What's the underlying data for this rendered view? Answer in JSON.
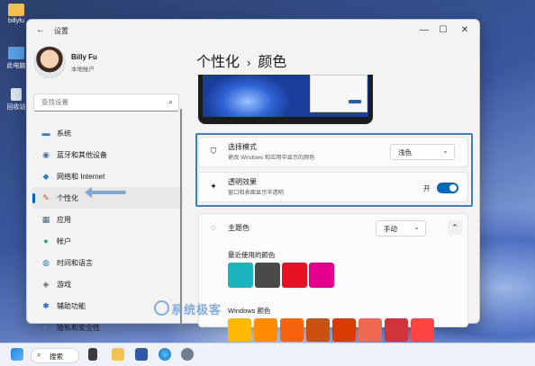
{
  "desktop": {
    "icons": [
      {
        "label": "billyfu",
        "icon": "folder-icon",
        "color": "#f2c14e"
      },
      {
        "label": "此电脑",
        "icon": "computer-icon",
        "color": "#5aa0e6"
      },
      {
        "label": "回收站",
        "icon": "recycle-bin-icon",
        "color": "#dfe6ef"
      }
    ]
  },
  "window": {
    "title": "设置",
    "controls": {
      "minimize": "—",
      "maximize": "☐",
      "close": "✕"
    }
  },
  "profile": {
    "name": "Billy Fu",
    "account_type": "本地帐户"
  },
  "search": {
    "placeholder": "查找设置"
  },
  "sidebar": {
    "items": [
      {
        "label": "系统",
        "icon": "system-icon",
        "glyph": "▬",
        "color": "#2b7bd0"
      },
      {
        "label": "蓝牙和其他设备",
        "icon": "bluetooth-icon",
        "glyph": "◉",
        "color": "#3a6fb8"
      },
      {
        "label": "网络和 Internet",
        "icon": "wifi-icon",
        "glyph": "◆",
        "color": "#2f7fcf"
      },
      {
        "label": "个性化",
        "icon": "brush-icon",
        "glyph": "✎",
        "color": "#c05a2a",
        "active": true
      },
      {
        "label": "应用",
        "icon": "apps-icon",
        "glyph": "▦",
        "color": "#4a5f7e"
      },
      {
        "label": "帐户",
        "icon": "person-icon",
        "glyph": "●",
        "color": "#2ba26a"
      },
      {
        "label": "时间和语言",
        "icon": "globe-clock-icon",
        "glyph": "◍",
        "color": "#2a7bc9"
      },
      {
        "label": "游戏",
        "icon": "gamepad-icon",
        "glyph": "◈",
        "color": "#5f6b78"
      },
      {
        "label": "辅助功能",
        "icon": "accessibility-icon",
        "glyph": "✱",
        "color": "#1f6fc8"
      },
      {
        "label": "隐私和安全性",
        "icon": "shield-icon",
        "glyph": "◐",
        "color": "#6a7788"
      }
    ]
  },
  "breadcrumb": {
    "parent": "个性化",
    "separator": "›",
    "current": "颜色"
  },
  "settings": {
    "mode": {
      "title": "选择模式",
      "desc": "更改 Windows 和应用中显示的颜色",
      "value": "浅色"
    },
    "transparency": {
      "title": "透明效果",
      "desc": "窗口和表面显示半透明",
      "state_label": "开",
      "on": true
    },
    "accent": {
      "title": "主题色",
      "value": "手动"
    },
    "recent_label": "最近使用的颜色",
    "recent_colors": [
      "#1bb5bf",
      "#4a4a4a",
      "#e81123",
      "#e3008c"
    ],
    "windows_colors_label": "Windows 颜色",
    "windows_colors": [
      "#ffb900",
      "#ff8c00",
      "#f7630c",
      "#ca5010",
      "#da3b01",
      "#ef6950",
      "#d13438",
      "#ff4343"
    ]
  },
  "watermark": {
    "text": "系统极客"
  },
  "taskbar": {
    "search_label": "搜索"
  },
  "accent_color": "#0067c0"
}
